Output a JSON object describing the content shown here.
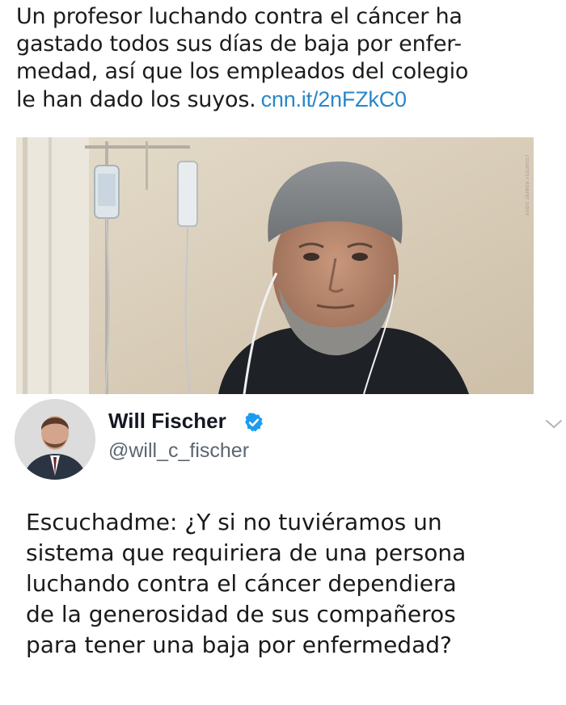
{
  "headline": {
    "lines": [
      "Un profesor luchando contra el cáncer ha",
      "gastado todos sus días de baja por enfer-",
      "medad, así que los empleados del colegio",
      "le han dado los suyos."
    ],
    "link": "cnn.it/2nFZkC0"
  },
  "photo": {
    "watermark": "COURTESY ROBERT SIDDY"
  },
  "tweet": {
    "display_name": "Will Fischer",
    "handle": "@will_c_fischer",
    "verified": true,
    "body_lines": [
      "Escuchadme: ¿Y si no tuviéramos un",
      "sistema que requiriera de una persona",
      "luchando contra el cáncer dependiera",
      "de la generosidad de sus compañeros",
      "para tener una baja por enfermedad?"
    ]
  },
  "colors": {
    "link": "#2a86c8",
    "verified": "#1d9bf0",
    "handle": "#5b6670"
  },
  "icons": {
    "verified": "verified-badge-icon",
    "menu": "chevron-down-icon"
  }
}
